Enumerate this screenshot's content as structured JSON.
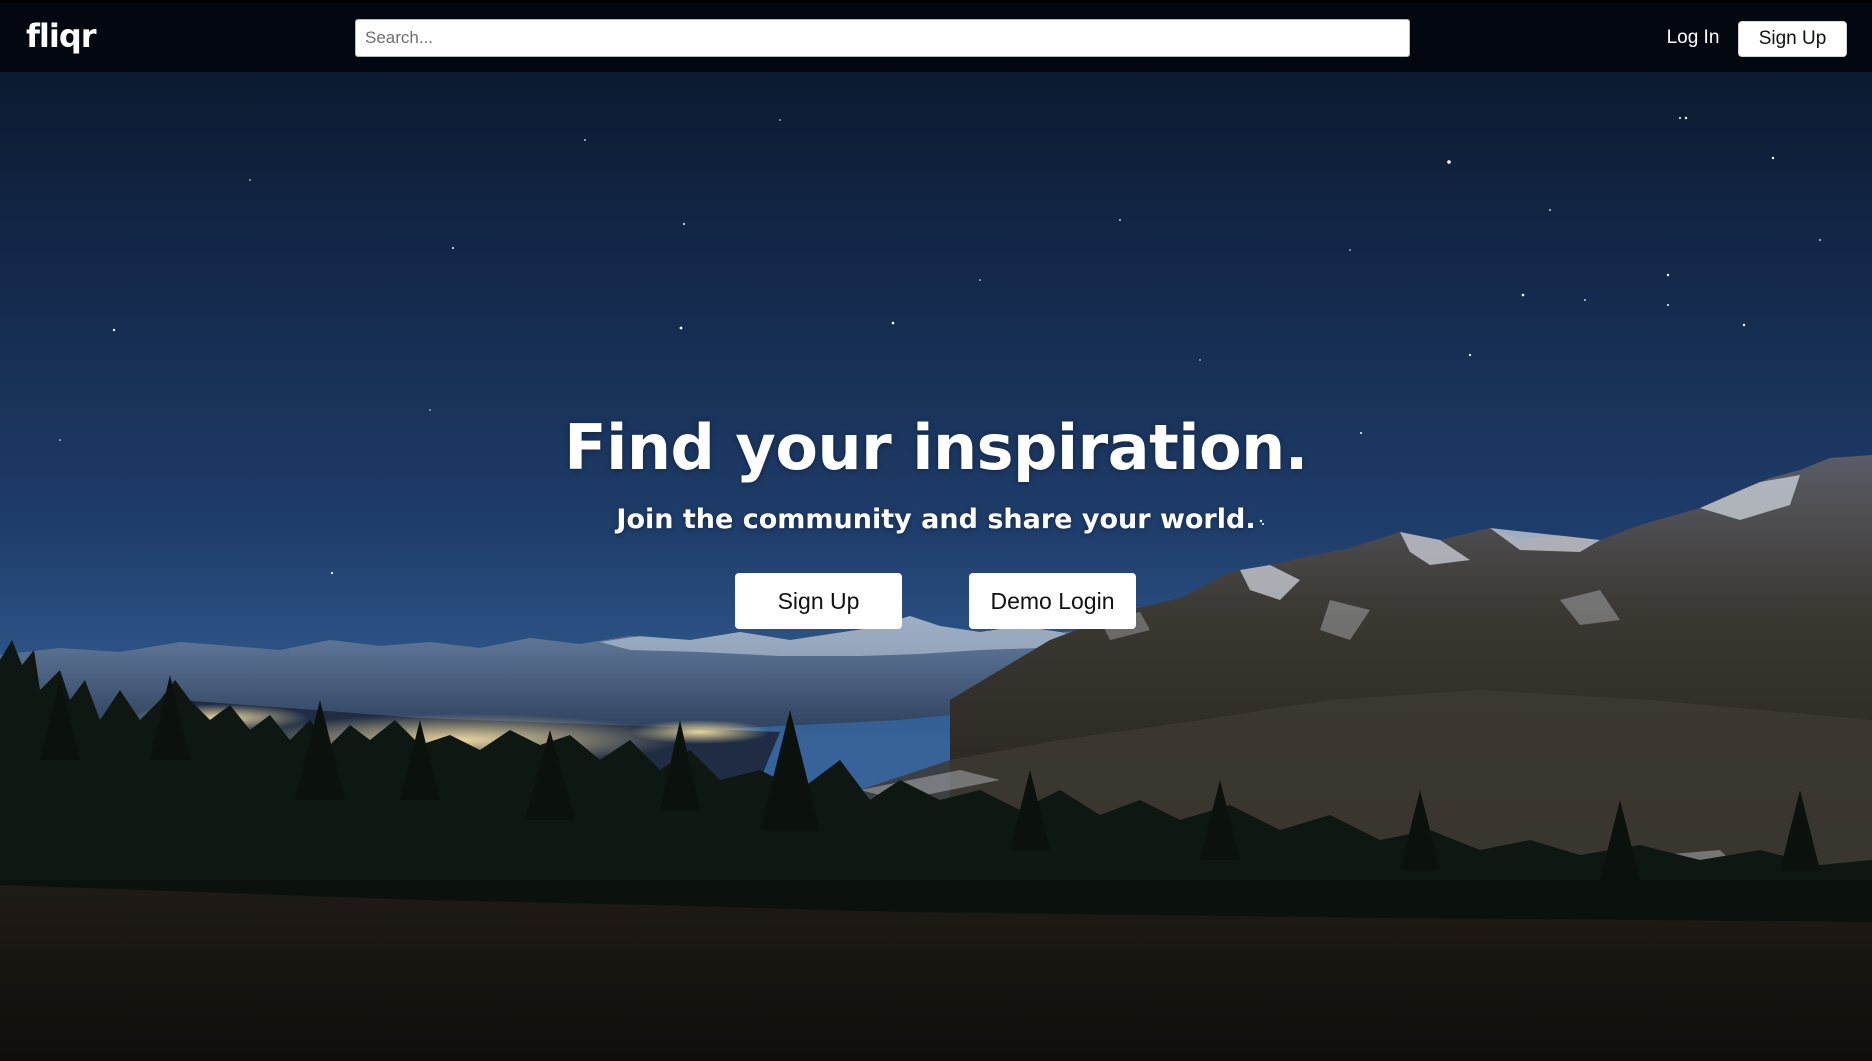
{
  "header": {
    "logo": "fliqr",
    "search": {
      "placeholder": "Search...",
      "value": ""
    },
    "login_label": "Log In",
    "signup_label": "Sign Up"
  },
  "hero": {
    "title": "Find your inspiration.",
    "subtitle": "Join the community and share your world.",
    "signup_label": "Sign Up",
    "demo_label": "Demo Login",
    "background": "night-sky-mountain-landscape"
  },
  "colors": {
    "navbar": "#02060e",
    "sky_top": "#0d1b33",
    "sky_mid": "#1f3d6b",
    "button_bg": "#ffffff"
  }
}
